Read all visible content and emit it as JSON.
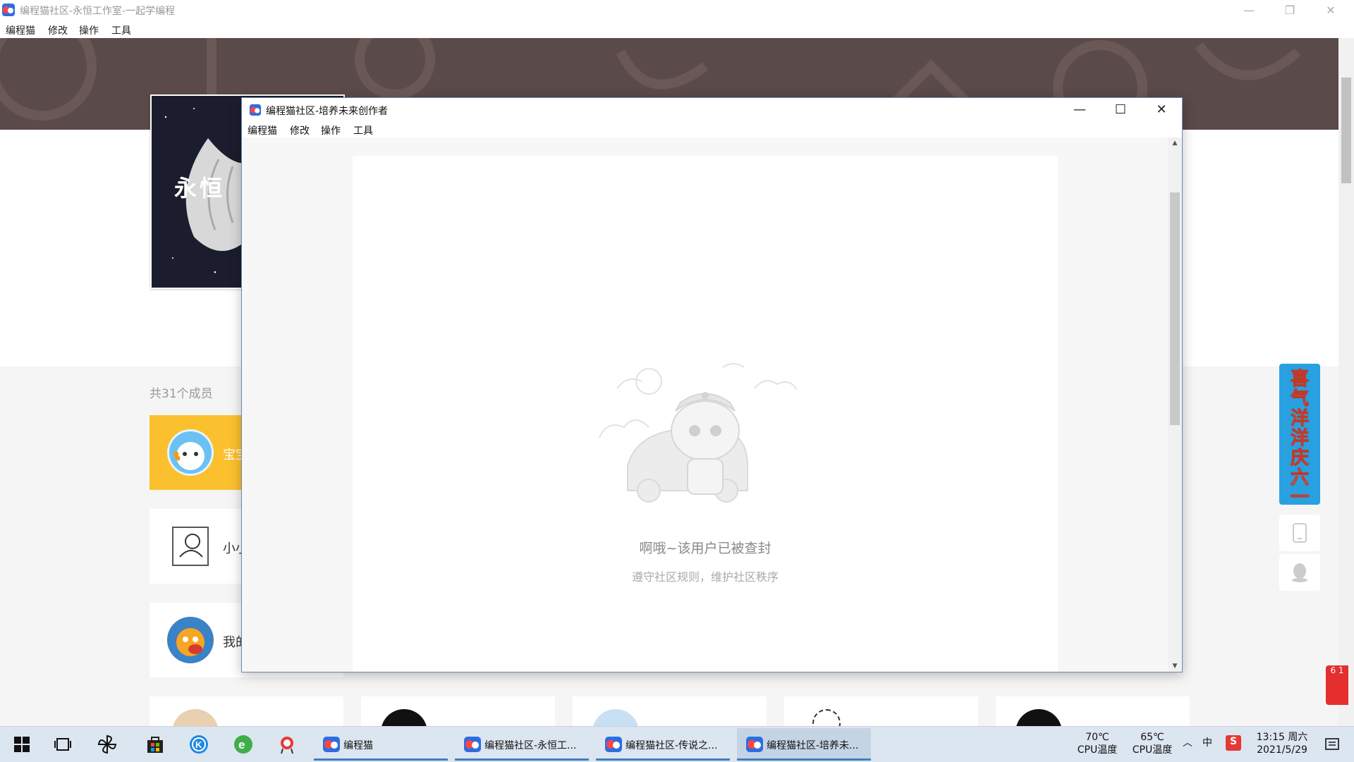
{
  "main_window": {
    "title": "编程猫社区-永恒工作室-一起学编程",
    "controls": {
      "minimize": "—",
      "maximize": "❐",
      "close": "✕"
    },
    "menu": [
      "编程猫",
      "修改",
      "操作",
      "工具"
    ]
  },
  "studio_page": {
    "logo_text": "永恒",
    "member_count": "共31个成员",
    "members": [
      {
        "name": "宝宝"
      },
      {
        "name": "小小"
      },
      {
        "name": "我的"
      }
    ]
  },
  "side_widgets": {
    "promo_text": "喜气洋洋庆六一",
    "red_badge": "6 1"
  },
  "popup_window": {
    "title": "编程猫社区-培养未来创作者",
    "controls": {
      "minimize": "—",
      "maximize": "☐",
      "close": "✕"
    },
    "menu": [
      "编程猫",
      "修改",
      "操作",
      "工具"
    ],
    "ban_title": "啊哦~该用户已被查封",
    "ban_subtitle": "遵守社区规则，维护社区秩序"
  },
  "taskbar": {
    "apps": [
      {
        "label": "编程猫",
        "active": false
      },
      {
        "label": "编程猫社区-永恒工...",
        "active": false
      },
      {
        "label": "编程猫社区-传说之...",
        "active": false
      },
      {
        "label": "编程猫社区-培养未...",
        "active": true
      }
    ],
    "tray": {
      "temp1_value": "70℃",
      "temp1_label": "CPU温度",
      "temp2_value": "65℃",
      "temp2_label": "CPU温度",
      "ime": "中",
      "time": "13:15 周六",
      "date": "2021/5/29"
    }
  }
}
